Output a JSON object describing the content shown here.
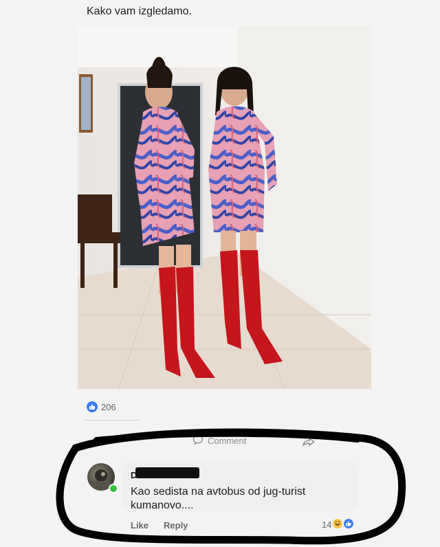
{
  "post": {
    "caption": "Kako vam izgledamo.",
    "reaction_count": "206"
  },
  "actions": {
    "comment_label": "Comment"
  },
  "comment": {
    "author": "D",
    "text": "Kao sedista na avtobus od jug-turist kumanovo....",
    "like_label": "Like",
    "reply_label": "Reply",
    "reaction_count": "14"
  },
  "colors": {
    "like_blue": "#3b7cf0",
    "haha_yellow": "#f7c64a",
    "online_green": "#34c13b",
    "boots_red": "#c4161c",
    "dress_blue": "#4b5fc7",
    "dress_pink": "#e7a0b4"
  },
  "icons": [
    "like-icon",
    "comment-icon",
    "share-icon",
    "haha-icon"
  ]
}
